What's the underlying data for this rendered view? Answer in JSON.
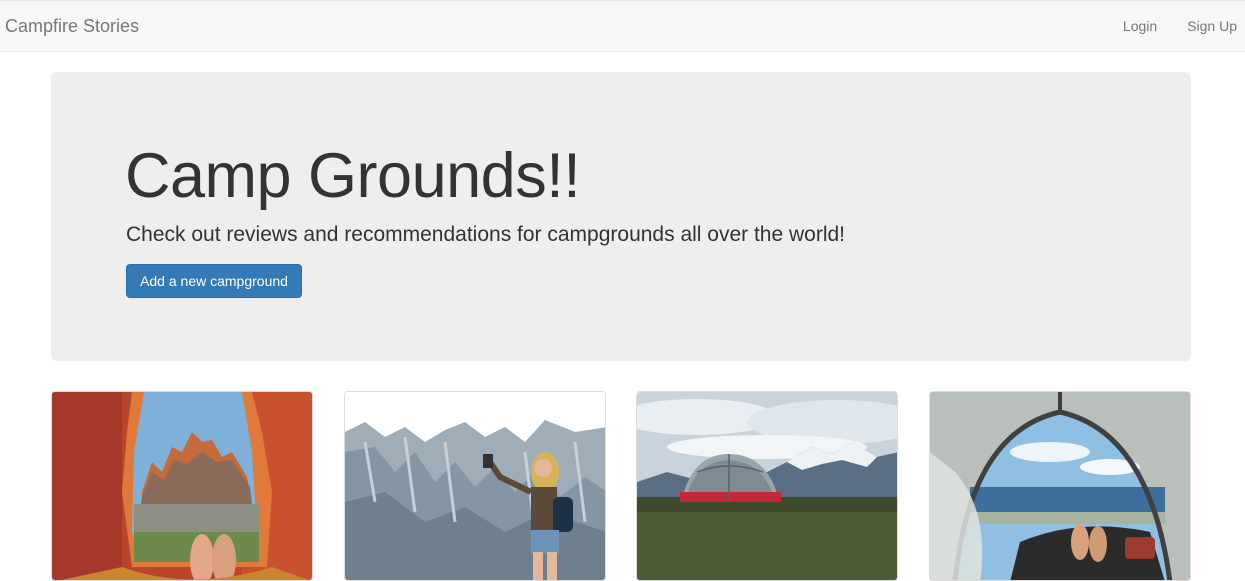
{
  "navbar": {
    "brand": "Campfire Stories",
    "links": [
      {
        "label": "Login"
      },
      {
        "label": "Sign Up"
      }
    ]
  },
  "jumbotron": {
    "title": "Camp Grounds!!",
    "subtitle": "Check out reviews and recommendations for campgrounds all over the world!",
    "button_label": "Add a new campground"
  },
  "colors": {
    "primary": "#337ab7",
    "navbar_bg": "#f8f8f8",
    "jumbotron_bg": "#eeeeee"
  }
}
